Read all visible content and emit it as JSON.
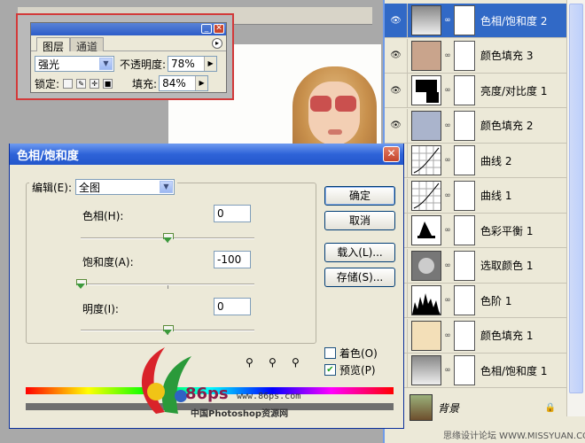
{
  "layers_mini": {
    "tab_layers": "图层",
    "tab_channels": "通道",
    "blend_mode": "强光",
    "opacity_label": "不透明度:",
    "opacity_value": "78%",
    "lock_label": "锁定:",
    "fill_label": "填充:",
    "fill_value": "84%"
  },
  "layers": [
    {
      "name": "色相/饱和度 2",
      "thumb": "hue-sat",
      "selected": true,
      "eye": true
    },
    {
      "name": "颜色填充 3",
      "thumb": "fill",
      "color": "#c9a48c",
      "eye": true
    },
    {
      "name": "亮度/对比度 1",
      "thumb": "brightness",
      "eye": true
    },
    {
      "name": "颜色填充 2",
      "thumb": "fill",
      "color": "#aab4cc",
      "eye": true
    },
    {
      "name": "曲线 2",
      "thumb": "curves",
      "eye": false
    },
    {
      "name": "曲线 1",
      "thumb": "curves",
      "eye": false
    },
    {
      "name": "色彩平衡 1",
      "thumb": "balance",
      "eye": false
    },
    {
      "name": "选取颜色 1",
      "thumb": "selective",
      "eye": false
    },
    {
      "name": "色阶 1",
      "thumb": "levels",
      "eye": false
    },
    {
      "name": "颜色填充 1",
      "thumb": "fill",
      "color": "#f3dfb8",
      "eye": false
    },
    {
      "name": "色相/饱和度 1",
      "thumb": "hue-sat",
      "eye": false
    }
  ],
  "background_layer": {
    "name": "背景",
    "lock": "🔒"
  },
  "dialog": {
    "title": "色相/饱和度",
    "edit_label": "编辑(E):",
    "edit_value": "全图",
    "hue_label": "色相(H):",
    "hue_value": "0",
    "saturation_label": "饱和度(A):",
    "saturation_value": "-100",
    "lightness_label": "明度(I):",
    "lightness_value": "0",
    "ok": "确定",
    "cancel": "取消",
    "load": "载入(L)...",
    "save": "存储(S)...",
    "colorize": "着色(O)",
    "preview": "预览(P)",
    "preview_checked": true,
    "colorize_checked": false,
    "hue_knob": 0.5,
    "saturation_knob": 0.0,
    "lightness_knob": 0.5
  },
  "logo": {
    "number": "86ps",
    "url": "www.86ps.com",
    "site_name": "中国Photoshop资源网"
  },
  "watermark": "思缘设计论坛 WWW.MISSYUAN.COM",
  "icons": {
    "eye": "eye-icon",
    "chain": "chain-link-icon",
    "lock": "lock-icon",
    "dropper": "eyedropper-icon"
  }
}
